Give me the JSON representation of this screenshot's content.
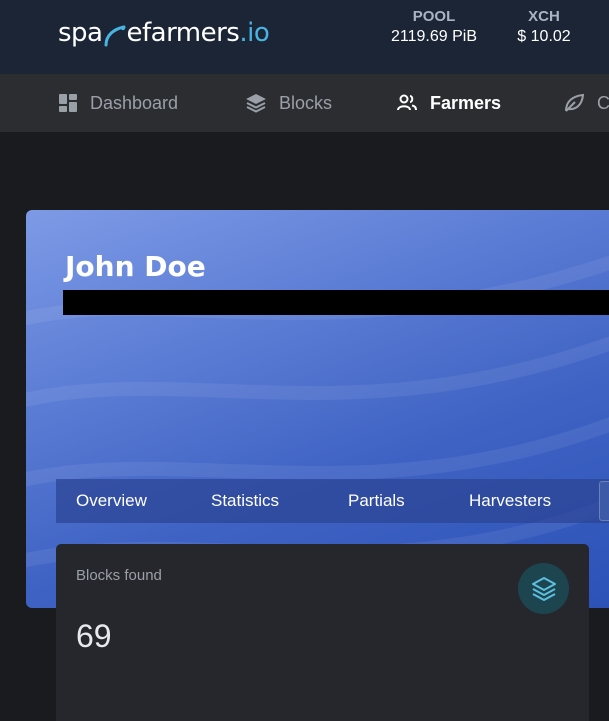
{
  "header": {
    "logo_main": "spacefarmers",
    "logo_suffix": ".io",
    "pool_label": "POOL",
    "pool_value": "2119.69 PiB",
    "xch_label": "XCH",
    "xch_value": "$ 10.02",
    "logo_accent_color": "#47b4e2"
  },
  "nav": {
    "items": [
      {
        "label": "Dashboard",
        "icon": "grid-icon",
        "active": false
      },
      {
        "label": "Blocks",
        "icon": "layers-icon",
        "active": false
      },
      {
        "label": "Farmers",
        "icon": "users-icon",
        "active": true
      },
      {
        "label": "C",
        "icon": "leaf-icon",
        "active": false
      }
    ]
  },
  "profile": {
    "name": "John Doe"
  },
  "tabs": [
    {
      "label": "Overview"
    },
    {
      "label": "Statistics"
    },
    {
      "label": "Partials"
    },
    {
      "label": "Harvesters"
    }
  ],
  "stats_card": {
    "label": "Blocks found",
    "value": "69",
    "icon": "layers-icon",
    "icon_color": "#5bc0de"
  }
}
